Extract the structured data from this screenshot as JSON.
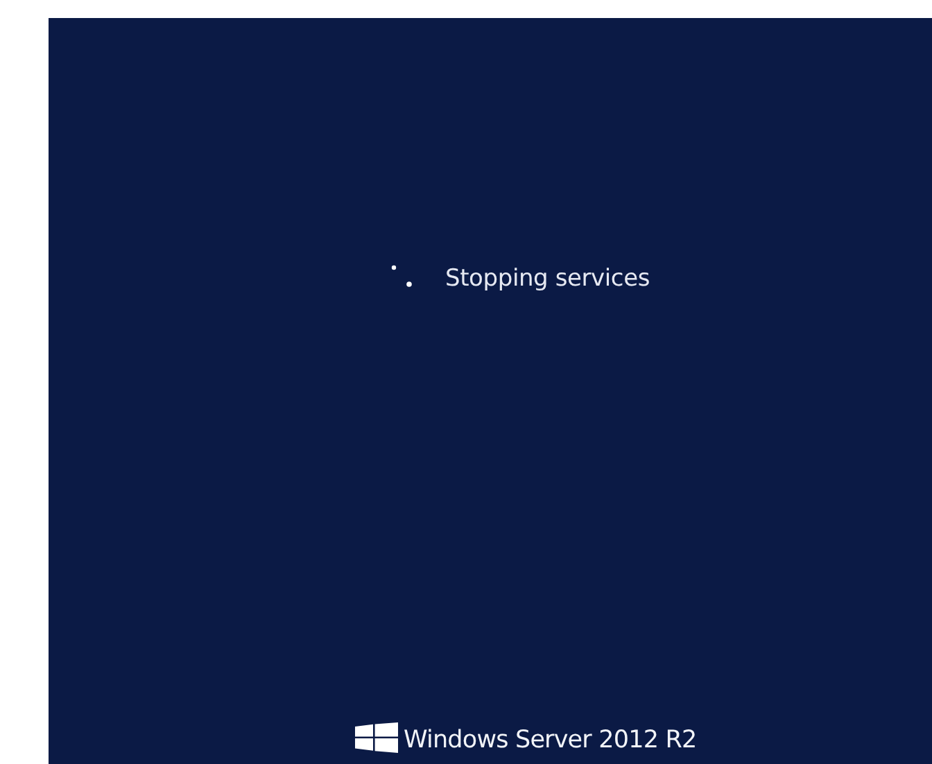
{
  "status": {
    "message": "Stopping services"
  },
  "branding": {
    "product": "Windows Server 2012 R2"
  }
}
